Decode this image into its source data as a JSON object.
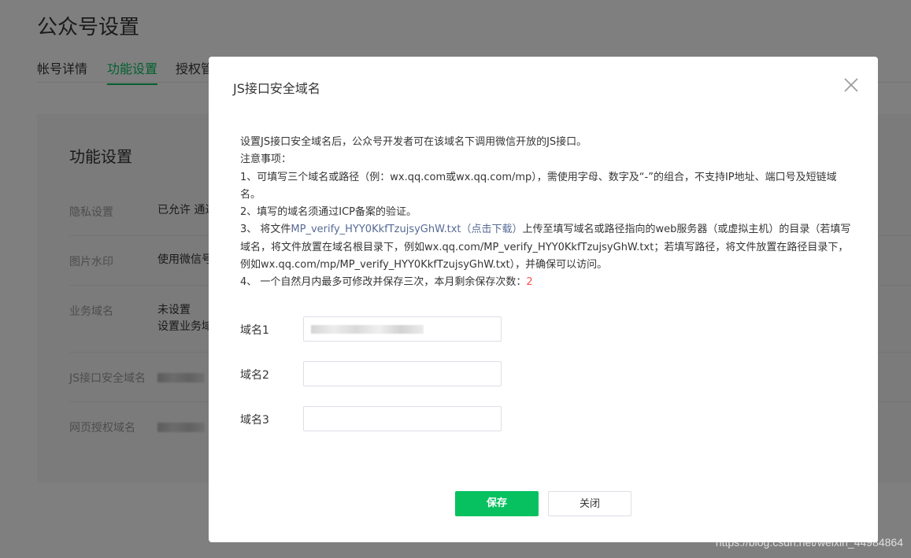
{
  "page": {
    "title": "公众号设置",
    "tabs": [
      "帐号详情",
      "功能设置",
      "授权管"
    ]
  },
  "panel": {
    "title": "功能设置",
    "rows": [
      {
        "label": "隐私设置",
        "value": "已允许 通过"
      },
      {
        "label": "图片水印",
        "value": "使用微信号"
      },
      {
        "label": "业务域名",
        "value": "未设置",
        "value2": "设置业务域"
      },
      {
        "label": "JS接口安全域名",
        "value": ""
      },
      {
        "label": "网页授权域名",
        "value": ""
      }
    ]
  },
  "dialog": {
    "title": "JS接口安全域名",
    "intro": "设置JS接口安全域名后，公众号开发者可在该域名下调用微信开放的JS接口。",
    "notice_heading": "注意事项：",
    "item1": "1、可填写三个域名或路径（例：wx.qq.com或wx.qq.com/mp），需使用字母、数字及“-”的组合，不支持IP地址、端口号及短链域名。",
    "item2": "2、填写的域名须通过ICP备案的验证。",
    "item3_prefix": "3、 将文件",
    "item3_link": "MP_verify_HYY0KkfTzujsyGhW.txt（点击下载）",
    "item3_suffix": "上传至填写域名或路径指向的web服务器（或虚拟主机）的目录（若填写域名，将文件放置在域名根目录下，例如wx.qq.com/MP_verify_HYY0KkfTzujsyGhW.txt；若填写路径，将文件放置在路径目录下，例如wx.qq.com/mp/MP_verify_HYY0KkfTzujsyGhW.txt），并确保可以访问。",
    "item4_prefix": "4、 一个自然月内最多可修改并保存三次，本月剩余保存次数：",
    "item4_count": "2",
    "domains": [
      {
        "label": "域名1",
        "value": ""
      },
      {
        "label": "域名2",
        "value": ""
      },
      {
        "label": "域名3",
        "value": ""
      }
    ],
    "save_label": "保存",
    "close_label": "关闭"
  },
  "watermark": "https://blog.csdn.net/weixin_44984864",
  "colors": {
    "accent": "#07c160",
    "link": "#576b95",
    "warning": "#fa5151"
  }
}
